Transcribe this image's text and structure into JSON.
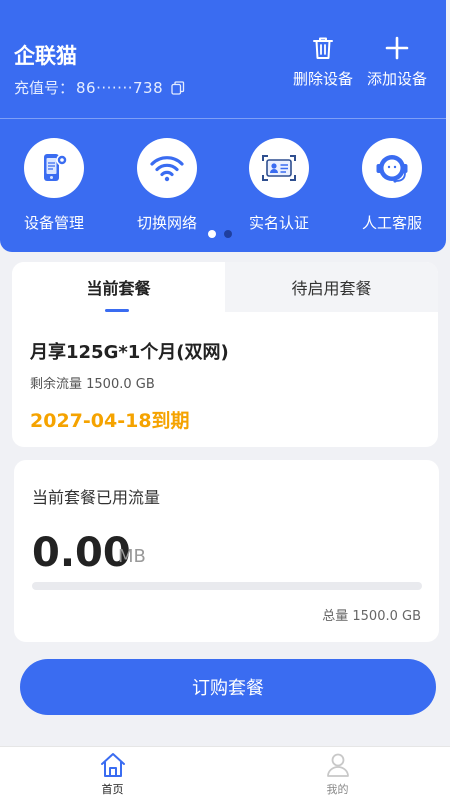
{
  "header": {
    "title": "企联猫",
    "recharge_label": "充值号：",
    "recharge_value": "86·······738",
    "actions": [
      {
        "label": "删除设备",
        "icon": "trash-icon"
      },
      {
        "label": "添加设备",
        "icon": "plus-icon"
      }
    ]
  },
  "quick_actions": [
    {
      "label": "设备管理",
      "icon": "device-settings-icon"
    },
    {
      "label": "切换网络",
      "icon": "wifi-icon"
    },
    {
      "label": "实名认证",
      "icon": "id-card-icon"
    },
    {
      "label": "人工客服",
      "icon": "headset-agent-icon"
    }
  ],
  "carousel": {
    "page_count": 2,
    "active_index": 0
  },
  "plan_card": {
    "tabs": [
      {
        "label": "当前套餐",
        "active": true
      },
      {
        "label": "待启用套餐",
        "active": false
      }
    ],
    "plan_name": "月享125G*1个月(双网)",
    "remaining": "剩余流量 1500.0 GB",
    "expire": "2027-04-18到期"
  },
  "usage_card": {
    "title": "当前套餐已用流量",
    "used_value": "0.00",
    "unit": "MB",
    "progress_fraction": 0,
    "total": "总量 1500.0 GB"
  },
  "buy_button": {
    "label": "订购套餐"
  },
  "bottom_nav": [
    {
      "label": "首页",
      "icon": "home-icon",
      "active": true
    },
    {
      "label": "我的",
      "icon": "user-icon",
      "active": false
    }
  ],
  "colors": {
    "primary": "#3a6cf1",
    "accent_orange": "#f5a300",
    "background": "#f0f1f5"
  }
}
